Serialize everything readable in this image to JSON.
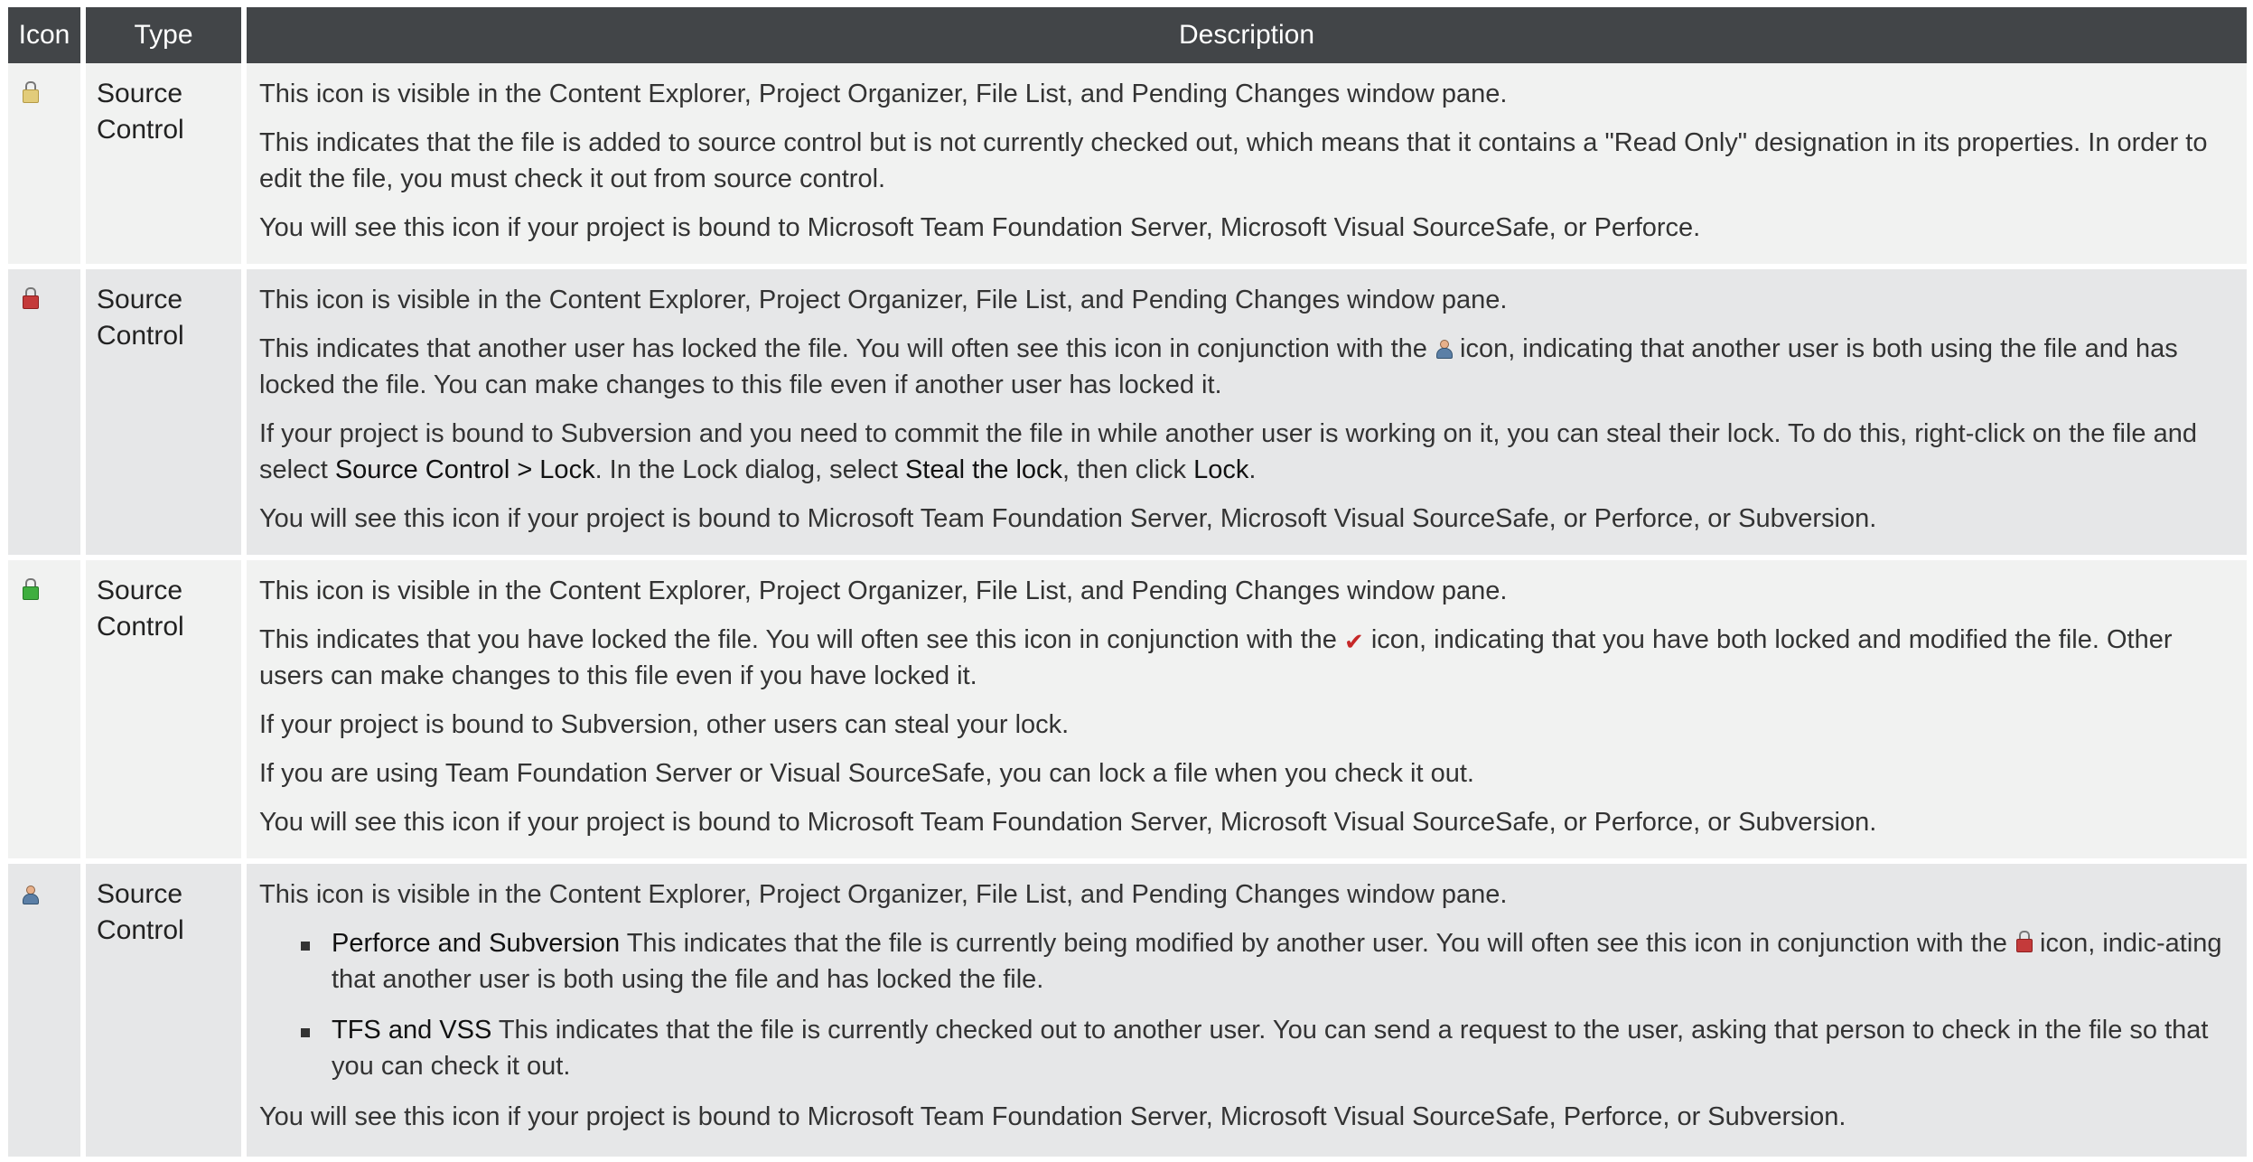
{
  "header": {
    "icon": "Icon",
    "type": "Type",
    "description": "Description"
  },
  "rows": [
    {
      "icon": "yellow-lock-icon",
      "type": "Source Control",
      "p1": "This icon is visible in the Content Explorer, Project Organizer, File List, and Pending Changes window pane.",
      "p2": "This indicates that the file is added to source control but is not currently checked out, which means that it contains a \"Read Only\" designation in its properties. In order to edit the file, you must check it out from source control.",
      "p3": "You will see this icon if your project is bound to Microsoft Team Foundation Server, Microsoft Visual SourceSafe, or Perforce."
    },
    {
      "icon": "red-lock-icon",
      "type": "Source Control",
      "p1": "This icon is visible in the Content Explorer, Project Organizer, File List, and Pending Changes window pane.",
      "p2_a": "This indicates that another user has locked the file. You will often see this icon in conjunction with the ",
      "p2_b": " icon, indicating that another user is both using the file and has locked the file. You can make changes to this file even if another user has locked it.",
      "p3_a": "If your project is bound to Subversion and you need to commit the file in while another user is working on it, you can steal their lock. To do this, right-click on the file and select ",
      "p3_b1": "Source Control > Lock",
      "p3_c": ". In the Lock dialog, select ",
      "p3_b2": "Steal the lock",
      "p3_d": ", then click ",
      "p3_b3": "Lock",
      "p3_e": ".",
      "p4": "You will see this icon if your project is bound to Microsoft Team Foundation Server, Microsoft Visual SourceSafe, or Perforce, or Subversion."
    },
    {
      "icon": "green-lock-icon",
      "type": "Source Control",
      "p1": "This icon is visible in the Content Explorer, Project Organizer, File List, and Pending Changes window pane.",
      "p2_a": "This indicates that you have locked the file. You will often see this icon in conjunction with the ",
      "p2_b": " icon, indicating that you have both locked and modified the file. Other users can make changes to this file even if you have locked it.",
      "p3": "If your project is bound to Subversion, other users can steal your lock.",
      "p4": "If you are using Team Foundation Server or Visual SourceSafe, you can lock a file when you check it out.",
      "p5": "You will see this icon if your project is bound to Microsoft Team Foundation Server, Microsoft Visual SourceSafe, or Perforce, or Subversion."
    },
    {
      "icon": "user-icon",
      "type": "Source Control",
      "p1": "This icon is visible in the Content Explorer, Project Organizer, File List, and Pending Changes window pane.",
      "li1_b": "Perforce and Subversion",
      "li1_a": " This indicates that the file is currently being modified by another user. You will often see this icon in conjunction with the ",
      "li1_c": " icon, indic-ating that another user is both using the file and has locked the file.",
      "li2_b": "TFS and VSS",
      "li2_a": " This indicates that the file is currently checked out to another user. You can send a request to the user, asking that person to check in the file so that you can check it out.",
      "p2": "You will see this icon if your project is bound to Microsoft Team Foundation Server, Microsoft Visual SourceSafe, Perforce, or Subversion."
    }
  ]
}
